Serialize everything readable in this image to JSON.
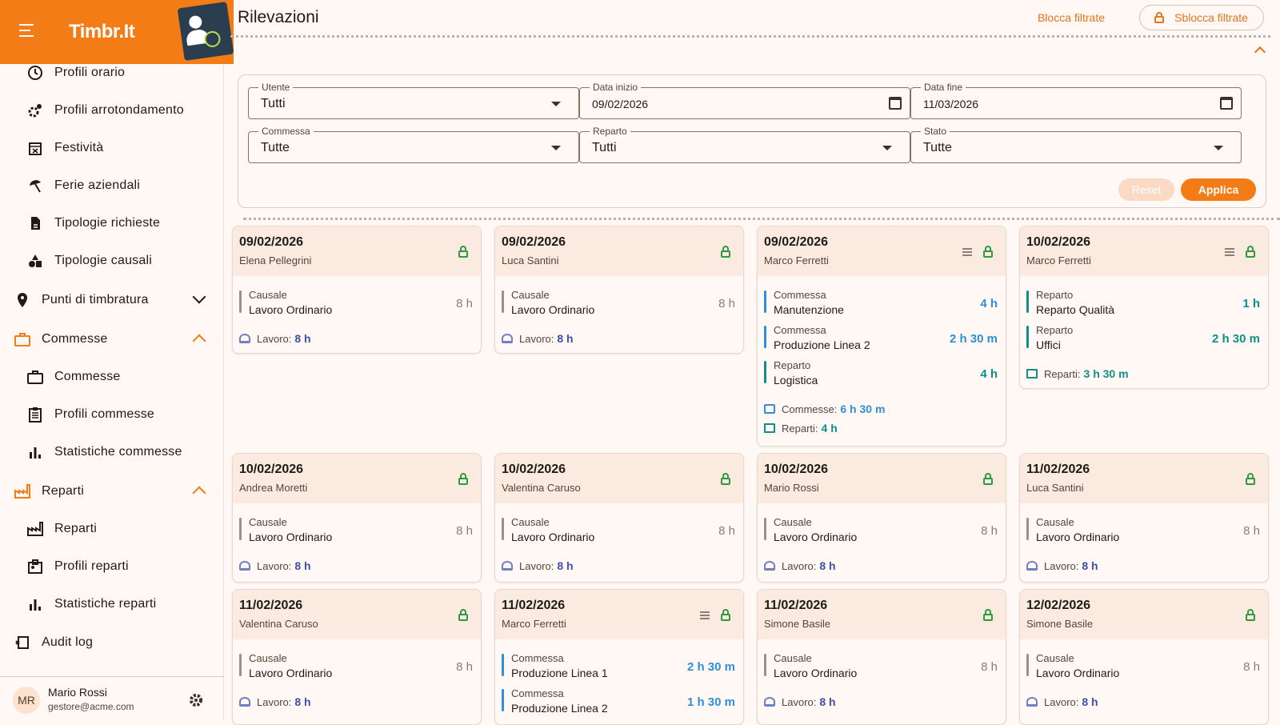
{
  "brand": {
    "name": "Timbr.It"
  },
  "sidebar": {
    "items": [
      {
        "label": "Profili orario",
        "icon": "clock-icon"
      },
      {
        "label": "Profili arrotondamento",
        "icon": "gears-icon"
      },
      {
        "label": "Festività",
        "icon": "calendar-x-icon"
      },
      {
        "label": "Ferie aziendali",
        "icon": "beach-icon"
      },
      {
        "label": "Tipologie richieste",
        "icon": "document-icon"
      },
      {
        "label": "Tipologie causali",
        "icon": "shapes-icon"
      },
      {
        "label": "Punti di timbratura",
        "icon": "location-pin-icon"
      },
      {
        "label": "Commesse",
        "icon": "briefcase-icon"
      },
      {
        "label": "Commesse",
        "icon": "briefcase-icon"
      },
      {
        "label": "Profili commesse",
        "icon": "clipboard-icon"
      },
      {
        "label": "Statistiche commesse",
        "icon": "bar-chart-icon"
      },
      {
        "label": "Reparti",
        "icon": "factory-icon"
      },
      {
        "label": "Reparti",
        "icon": "factory-icon"
      },
      {
        "label": "Profili reparti",
        "icon": "badge-icon"
      },
      {
        "label": "Statistiche reparti",
        "icon": "bar-chart-icon"
      },
      {
        "label": "Audit log",
        "icon": "history-icon"
      }
    ],
    "user": {
      "initials": "MR",
      "name": "Mario Rossi",
      "email": "gestore@acme.com"
    }
  },
  "header": {
    "title": "Rilevazioni",
    "lock_filtered": "Blocca filtrate",
    "unlock_filtered": "Sblocca filtrate"
  },
  "filters": {
    "user": {
      "label": "Utente",
      "value": "Tutti"
    },
    "start": {
      "label": "Data inizio",
      "value": "09/02/2026"
    },
    "end": {
      "label": "Data fine",
      "value": "11/03/2026"
    },
    "project": {
      "label": "Commessa",
      "value": "Tutte"
    },
    "department": {
      "label": "Reparto",
      "value": "Tutti"
    },
    "status": {
      "label": "Stato",
      "value": "Tutte"
    },
    "reset": "Reset",
    "apply": "Applica"
  },
  "colors": {
    "accent": "#f47c16",
    "lock": "#2e9a40",
    "project": "#2f8fd8",
    "department": "#0f8f88",
    "work": "#3c4fb0"
  },
  "cards": [
    {
      "date": "09/02/2026",
      "name": "Elena Pellegrini",
      "entries": [
        {
          "type": "Causale",
          "value": "Lavoro Ordinario",
          "hours": "8 h"
        }
      ],
      "work_label": "Lavoro:",
      "work": "8 h"
    },
    {
      "date": "09/02/2026",
      "name": "Luca Santini",
      "entries": [
        {
          "type": "Causale",
          "value": "Lavoro Ordinario",
          "hours": "8 h"
        }
      ],
      "work_label": "Lavoro:",
      "work": "8 h"
    },
    {
      "date": "09/02/2026",
      "name": "Marco Ferretti",
      "entries": [
        {
          "type": "Commessa",
          "value": "Manutenzione",
          "hours": "4 h"
        },
        {
          "type": "Commessa",
          "value": "Produzione Linea 2",
          "hours": "2 h 30 m"
        },
        {
          "type": "Reparto",
          "value": "Logistica",
          "hours": "4 h"
        }
      ],
      "comm_label": "Commesse:",
      "comm": "6 h 30 m",
      "rep_label": "Reparti:",
      "rep": "4 h"
    },
    {
      "date": "10/02/2026",
      "name": "Marco Ferretti",
      "entries": [
        {
          "type": "Reparto",
          "value": "Reparto Qualità",
          "hours": "1 h"
        },
        {
          "type": "Reparto",
          "value": "Uffici",
          "hours": "2 h 30 m"
        }
      ],
      "rep_label": "Reparti:",
      "rep": "3 h 30 m"
    },
    {
      "date": "10/02/2026",
      "name": "Andrea Moretti",
      "entries": [
        {
          "type": "Causale",
          "value": "Lavoro Ordinario",
          "hours": "8 h"
        }
      ],
      "work_label": "Lavoro:",
      "work": "8 h"
    },
    {
      "date": "10/02/2026",
      "name": "Valentina Caruso",
      "entries": [
        {
          "type": "Causale",
          "value": "Lavoro Ordinario",
          "hours": "8 h"
        }
      ],
      "work_label": "Lavoro:",
      "work": "8 h"
    },
    {
      "date": "10/02/2026",
      "name": "Mario Rossi",
      "entries": [
        {
          "type": "Causale",
          "value": "Lavoro Ordinario",
          "hours": "8 h"
        }
      ],
      "work_label": "Lavoro:",
      "work": "8 h"
    },
    {
      "date": "11/02/2026",
      "name": "Luca Santini",
      "entries": [
        {
          "type": "Causale",
          "value": "Lavoro Ordinario",
          "hours": "8 h"
        }
      ],
      "work_label": "Lavoro:",
      "work": "8 h"
    },
    {
      "date": "11/02/2026",
      "name": "Valentina Caruso",
      "entries": [
        {
          "type": "Causale",
          "value": "Lavoro Ordinario",
          "hours": "8 h"
        }
      ],
      "work_label": "Lavoro:",
      "work": "8 h"
    },
    {
      "date": "11/02/2026",
      "name": "Marco Ferretti",
      "entries": [
        {
          "type": "Commessa",
          "value": "Produzione Linea 1",
          "hours": "2 h 30 m"
        },
        {
          "type": "Commessa",
          "value": "Produzione Linea 2",
          "hours": "1 h 30 m"
        }
      ]
    },
    {
      "date": "11/02/2026",
      "name": "Simone Basile",
      "entries": [
        {
          "type": "Causale",
          "value": "Lavoro Ordinario",
          "hours": "8 h"
        }
      ],
      "work_label": "Lavoro:",
      "work": "8 h"
    },
    {
      "date": "12/02/2026",
      "name": "Simone Basile",
      "entries": [
        {
          "type": "Causale",
          "value": "Lavoro Ordinario",
          "hours": "8 h"
        }
      ],
      "work_label": "Lavoro:",
      "work": "8 h"
    }
  ]
}
